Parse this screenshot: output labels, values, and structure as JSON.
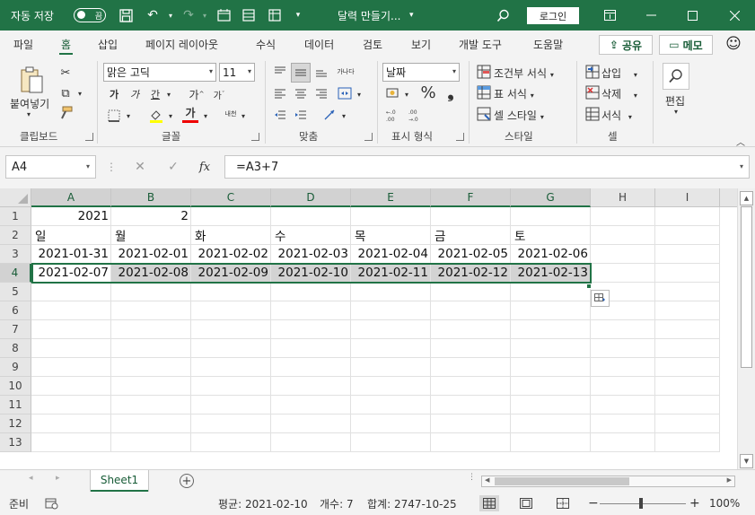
{
  "titlebar": {
    "autosave_label": "자동 저장",
    "autosave_state": "끔",
    "doc_title": "달력 만들기...",
    "login_label": "로그인"
  },
  "ribbon_tabs": [
    "파일",
    "홈",
    "삽입",
    "페이지 레이아웃",
    "수식",
    "데이터",
    "검토",
    "보기",
    "개발 도구",
    "도움말"
  ],
  "active_tab": "홈",
  "share_label": "공유",
  "memo_label": "메모",
  "clipboard": {
    "paste_label": "붙여넣기",
    "group_label": "클립보드"
  },
  "font": {
    "name": "맑은 고딕",
    "size": "11",
    "bold": "가",
    "italic": "가",
    "underline": "간",
    "grow": "가",
    "shrink": "가",
    "fill_char": "가",
    "phonetic": "내천",
    "group_label": "글꼴"
  },
  "alignment": {
    "wrap_text": "가나다",
    "group_label": "맞춤"
  },
  "number": {
    "format": "날짜",
    "group_label": "표시 형식"
  },
  "styles": {
    "conditional": "조건부 서식",
    "table": "표 서식",
    "cell_styles": "셀 스타일",
    "group_label": "스타일"
  },
  "cells": {
    "insert": "삽입",
    "delete": "삭제",
    "format": "서식",
    "group_label": "셀"
  },
  "editing": {
    "label": "편집"
  },
  "formula_bar": {
    "name_box": "A4",
    "fx": "fx",
    "formula": "=A3+7"
  },
  "columns": [
    "A",
    "B",
    "C",
    "D",
    "E",
    "F",
    "G",
    "H",
    "I"
  ],
  "rows": [
    "1",
    "2",
    "3",
    "4",
    "5",
    "6",
    "7",
    "8",
    "9",
    "10",
    "11",
    "12",
    "13"
  ],
  "cells_data": {
    "r1": [
      "2021",
      "2",
      "",
      "",
      "",
      "",
      ""
    ],
    "r2": [
      "일",
      "월",
      "화",
      "수",
      "목",
      "금",
      "토"
    ],
    "r3": [
      "2021-01-31",
      "2021-02-01",
      "2021-02-02",
      "2021-02-03",
      "2021-02-04",
      "2021-02-05",
      "2021-02-06"
    ],
    "r4": [
      "2021-02-07",
      "2021-02-08",
      "2021-02-09",
      "2021-02-10",
      "2021-02-11",
      "2021-02-12",
      "2021-02-13"
    ]
  },
  "sheet_tab": "Sheet1",
  "status": {
    "ready": "준비",
    "average": "평균: 2021-02-10",
    "count": "개수: 7",
    "sum": "합계: 2747-10-25",
    "zoom": "100%"
  },
  "colors": {
    "accent": "#217346",
    "selection_fill": "#d3d3d3"
  }
}
